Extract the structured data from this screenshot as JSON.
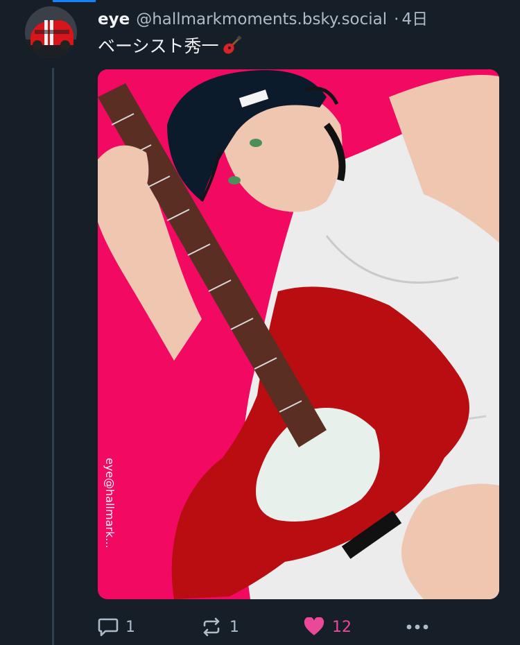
{
  "post": {
    "author_name": "eye",
    "author_handle": "@hallmarkmoments.bsky.social",
    "separator": "·",
    "time": "4日",
    "text": "ベーシスト秀一",
    "emoji": "guitar-emoji",
    "image_watermark": "eye@hallmark..."
  },
  "actions": {
    "reply_count": "1",
    "repost_count": "1",
    "like_count": "12",
    "liked": true
  },
  "colors": {
    "background": "#161e27",
    "text_primary": "#f1f3f5",
    "text_secondary": "#aebbc9",
    "accent_blue": "#1083fe",
    "like_pink": "#ec4899",
    "thread_line": "#2e4052",
    "artwork_background": "#f20a62"
  }
}
